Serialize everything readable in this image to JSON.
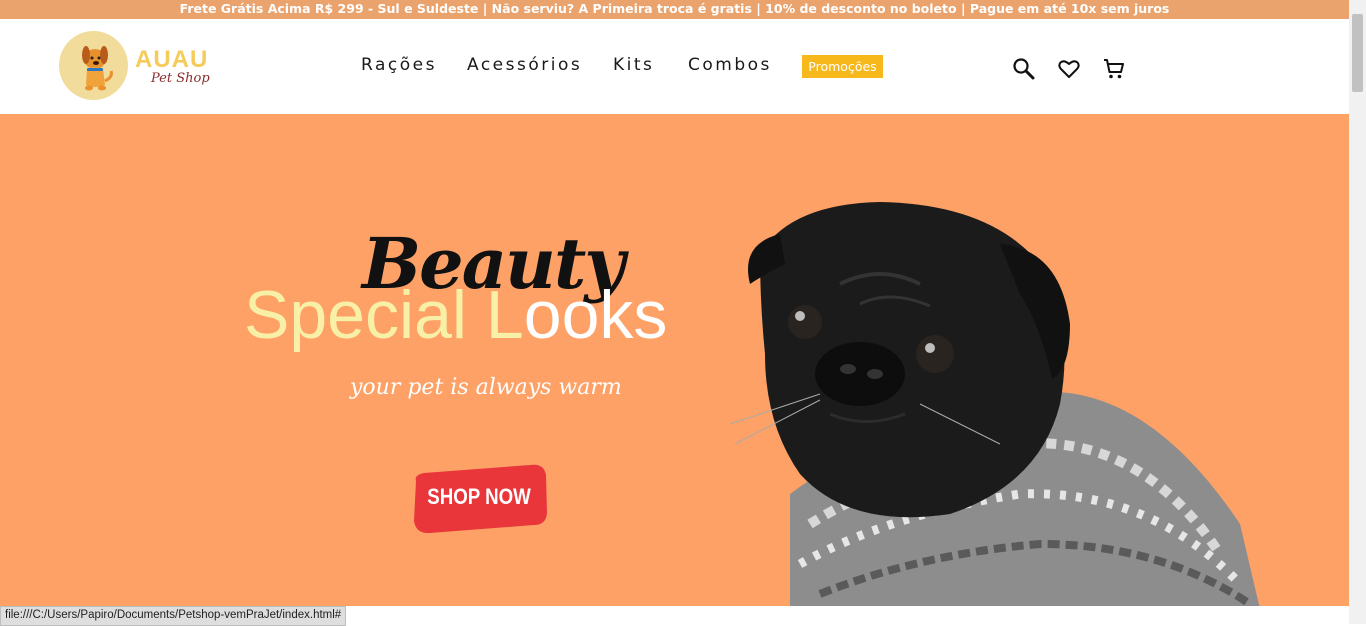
{
  "banner": {
    "text": "Frete Grátis Acima R$ 299 - Sul e Suldeste | Não serviu? A Primeira troca é gratis | 10% de desconto no boleto | Pague em até 10x sem juros"
  },
  "logo": {
    "main": "AUAU",
    "sub": "Pet Shop"
  },
  "nav": {
    "items": [
      "Rações",
      "Acessórios",
      "Kits",
      "Combos"
    ],
    "promo": "Promoções"
  },
  "header_icons": [
    "search-icon",
    "heart-icon",
    "cart-icon"
  ],
  "hero": {
    "script": "Beauty",
    "title_part1": "Special L",
    "title_part2": "ooks",
    "subtitle": "your pet is always warm",
    "button": "SHOP NOW"
  },
  "status_bar": {
    "url": "file:///C:/Users/Papiro/Documents/Petshop-vemPraJet/index.html#"
  },
  "colors": {
    "banner": "#eba36d",
    "hero_bg": "#fea166",
    "promo": "#f7b81b",
    "button": "#e8363a"
  }
}
